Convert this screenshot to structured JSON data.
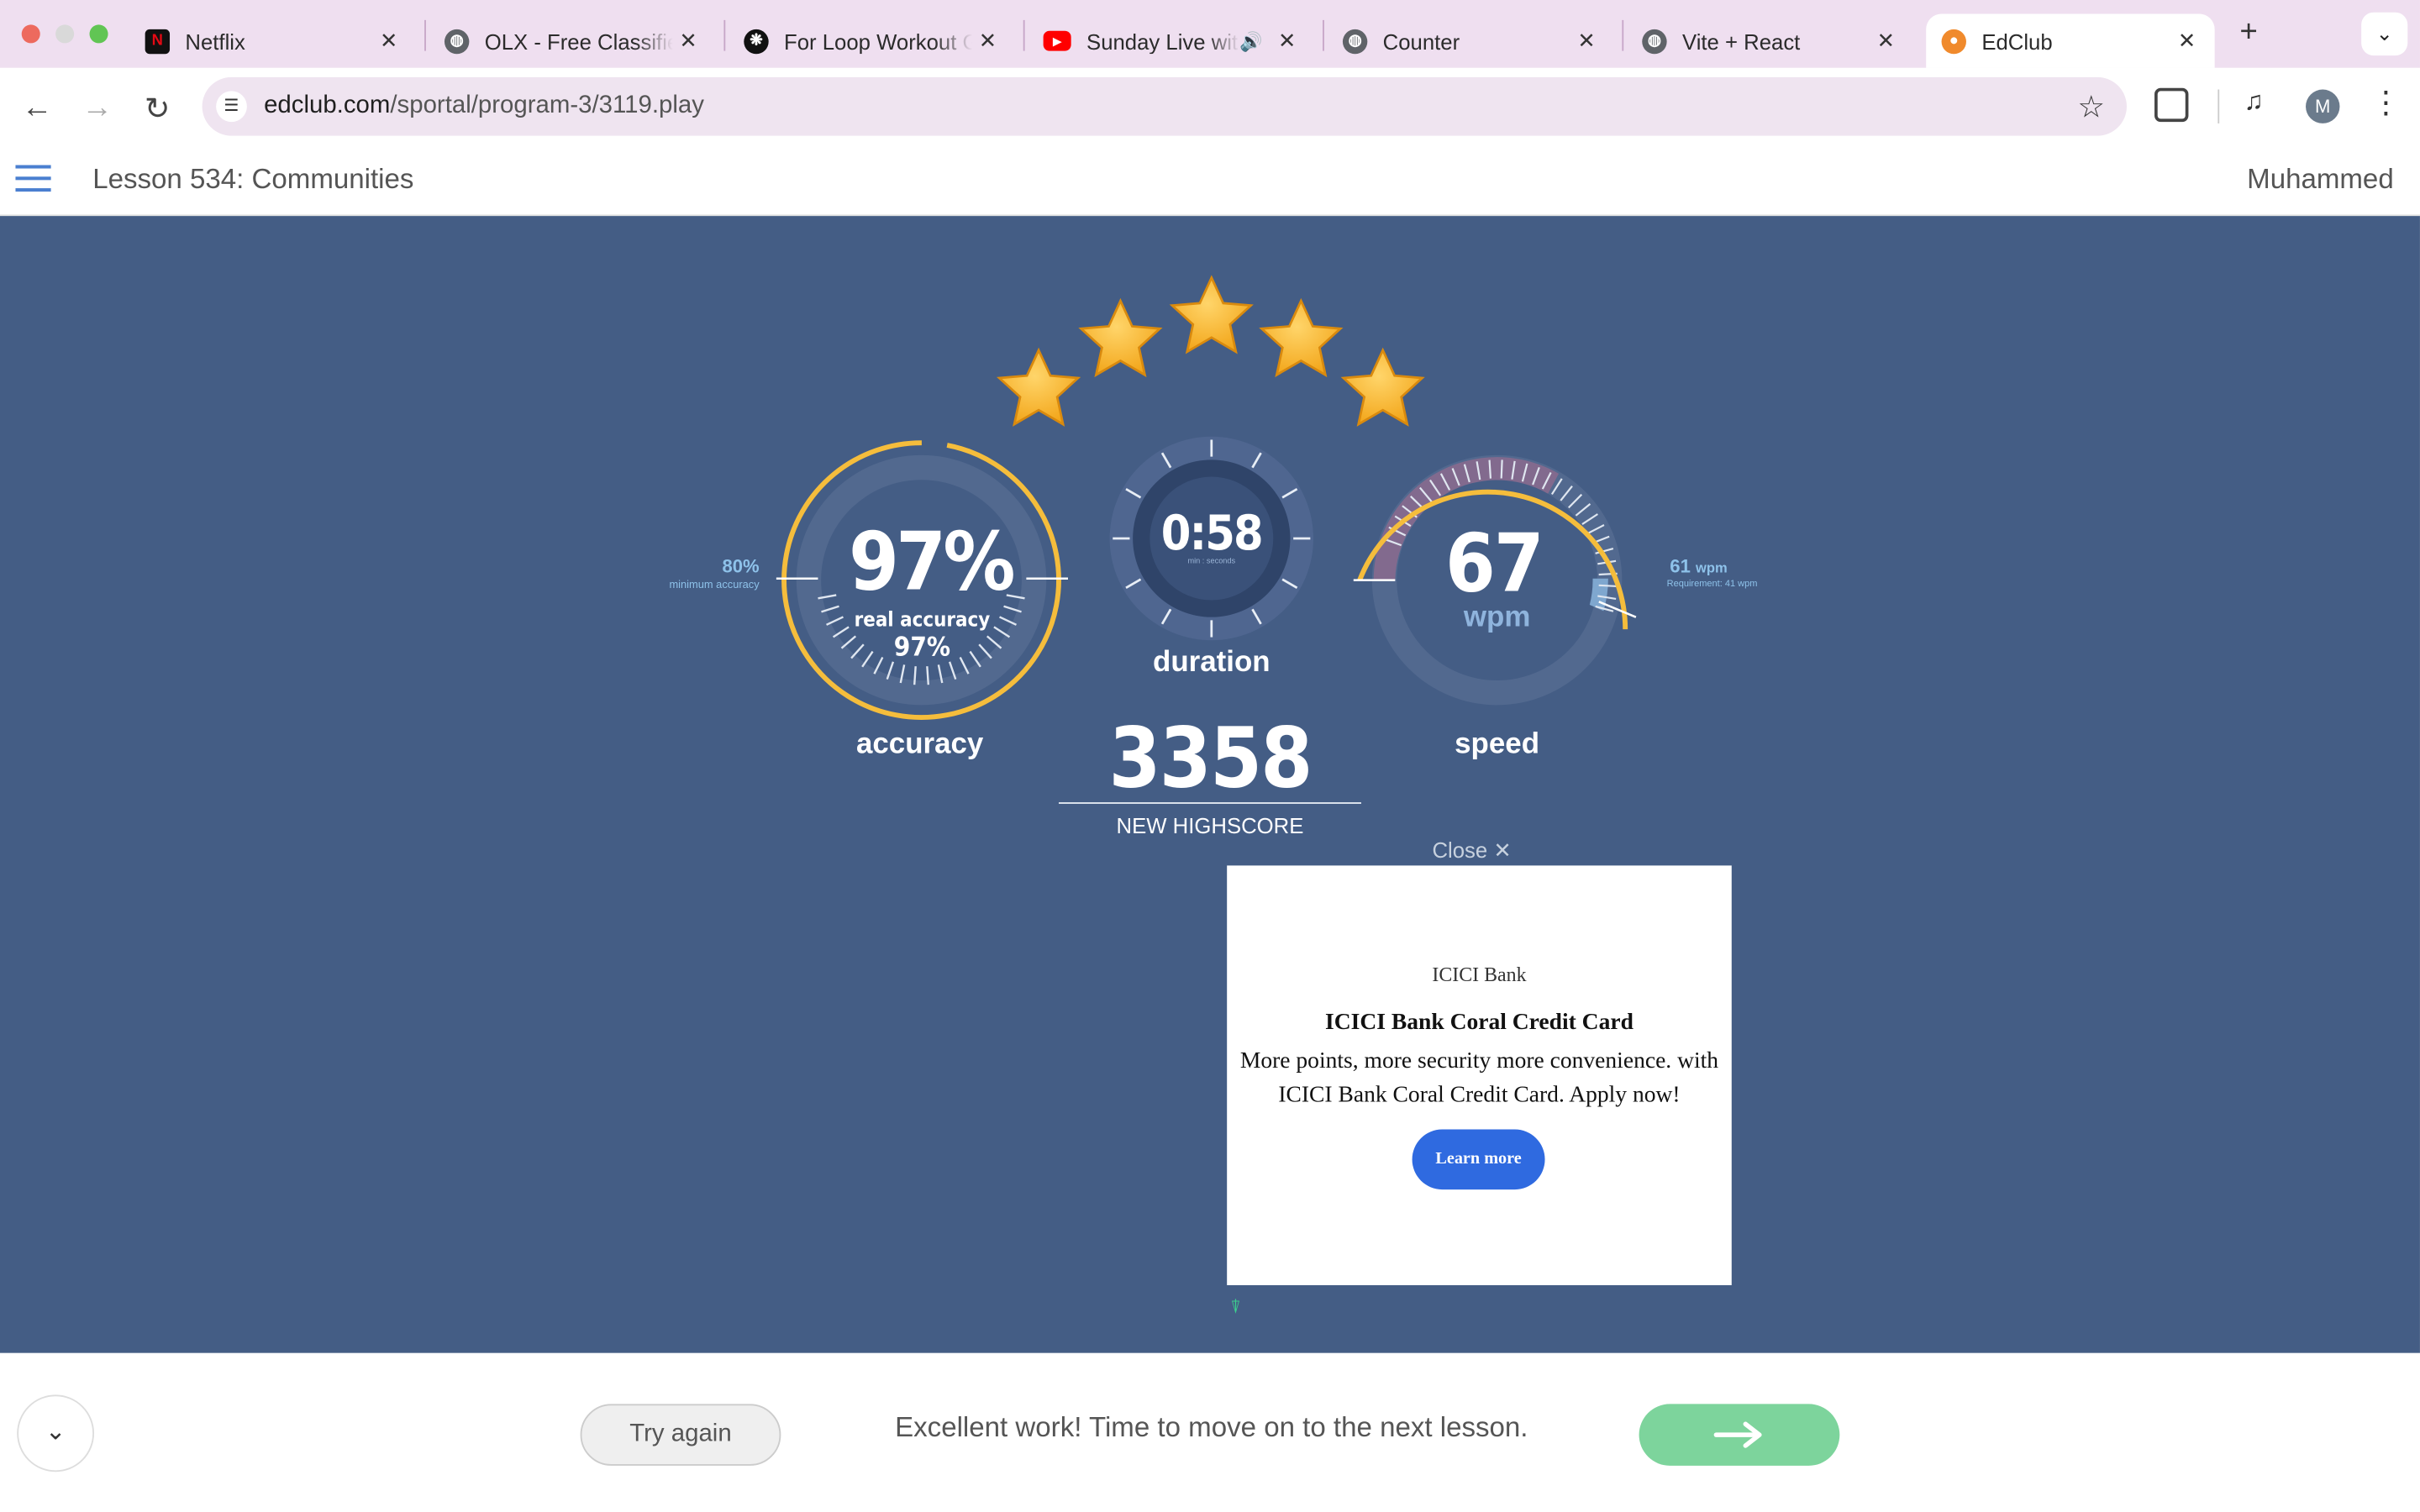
{
  "browser": {
    "tabs": [
      {
        "title": "Netflix",
        "icon": "netflix-icon"
      },
      {
        "title": "OLX - Free Classifieds",
        "icon": "globe-icon"
      },
      {
        "title": "For Loop Workout Guide",
        "icon": "openai-icon"
      },
      {
        "title": "Sunday Live with",
        "icon": "youtube-icon"
      },
      {
        "title": "Counter",
        "icon": "globe-icon"
      },
      {
        "title": "Vite + React",
        "icon": "globe-icon"
      },
      {
        "title": "EdClub",
        "icon": "edclub-icon"
      }
    ],
    "url_domain": "edclub.com",
    "url_path": "/sportal/program-3/3119.play",
    "profile_initial": "M"
  },
  "header": {
    "lesson_title": "Lesson 534: Communities",
    "user_name": "Muhammed"
  },
  "results": {
    "stars": 5,
    "accuracy": {
      "value": "97%",
      "sub_label": "real accuracy",
      "sub_value": "97%",
      "label": "accuracy",
      "min_value": "80%",
      "min_label": "minimum accuracy",
      "fraction": 0.97,
      "min_fraction": 0.8
    },
    "duration": {
      "value": "0:58",
      "unit": "min : seconds",
      "label": "duration"
    },
    "speed": {
      "value": "67",
      "unit": "wpm",
      "label": "speed",
      "req_value": "61",
      "req_unit": "wpm",
      "req_label": "Requirement: 41 wpm"
    },
    "score": {
      "value": "3358",
      "label": "NEW HIGHSCORE"
    }
  },
  "ad": {
    "close_label": "Close",
    "advertiser": "ICICI Bank",
    "headline": "ICICI Bank Coral Credit Card",
    "body": "More points, more security more convenience. with ICICI Bank Coral Credit Card. Apply now!",
    "cta": "Learn more"
  },
  "footer": {
    "try_again": "Try again",
    "message": "Excellent work! Time to move on to the next lesson.",
    "next_icon": "arrow-right-icon"
  },
  "colors": {
    "page_bg": "#445d85",
    "gauge_gold": "#f5bd3c",
    "next_green": "#7dd49c",
    "ad_cta": "#2f6ae0"
  }
}
